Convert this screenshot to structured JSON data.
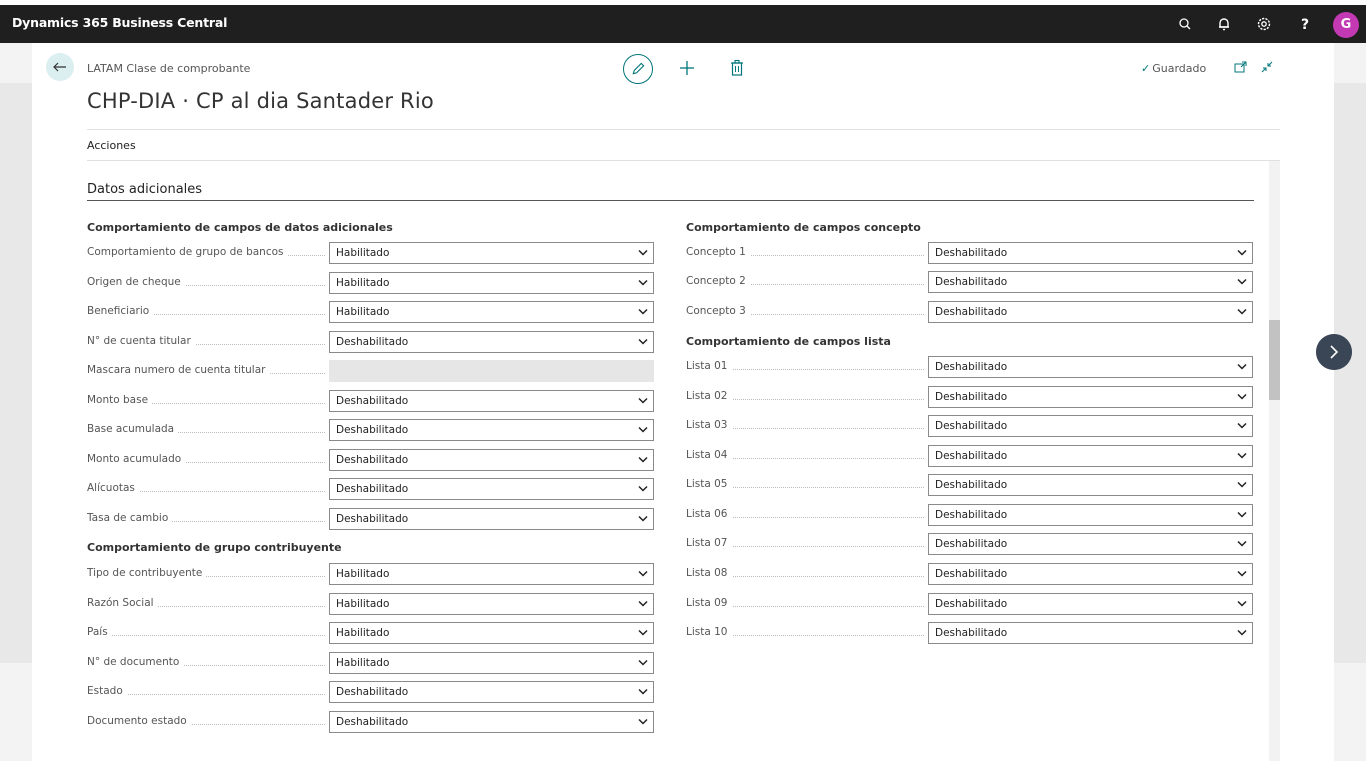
{
  "app": {
    "title": "Dynamics 365 Business Central",
    "avatar_initial": "G",
    "avatar_color": "#c239b3",
    "icons": [
      "search-icon",
      "bell-icon",
      "gear-icon",
      "help-icon"
    ]
  },
  "header": {
    "breadcrumb": "LATAM Clase de comprobante",
    "title": "CHP-DIA · CP al dia Santader Rio",
    "saved_label": "Guardado",
    "actions_label": "Acciones"
  },
  "section": {
    "title": "Datos adicionales"
  },
  "left_groups": [
    {
      "title": "Comportamiento de campos de datos adicionales",
      "fields": [
        {
          "label": "Comportamiento de grupo de bancos",
          "value": "Habilitado"
        },
        {
          "label": "Origen de cheque",
          "value": "Habilitado"
        },
        {
          "label": "Beneficiario",
          "value": "Habilitado"
        },
        {
          "label": "N° de cuenta titular",
          "value": "Deshabilitado"
        },
        {
          "label": "Mascara numero de cuenta titular",
          "value": ""
        },
        {
          "label": "Monto base",
          "value": "Deshabilitado"
        },
        {
          "label": "Base acumulada",
          "value": "Deshabilitado"
        },
        {
          "label": "Monto acumulado",
          "value": "Deshabilitado"
        },
        {
          "label": "Alícuotas",
          "value": "Deshabilitado"
        },
        {
          "label": "Tasa de cambio",
          "value": "Deshabilitado"
        }
      ]
    },
    {
      "title": "Comportamiento de grupo contribuyente",
      "fields": [
        {
          "label": "Tipo de contribuyente",
          "value": "Habilitado"
        },
        {
          "label": "Razón Social",
          "value": "Habilitado"
        },
        {
          "label": "País",
          "value": "Habilitado"
        },
        {
          "label": "N° de documento",
          "value": "Habilitado"
        },
        {
          "label": "Estado",
          "value": "Deshabilitado"
        },
        {
          "label": "Documento estado",
          "value": "Deshabilitado"
        }
      ]
    }
  ],
  "right_groups": [
    {
      "title": "Comportamiento de campos concepto",
      "fields": [
        {
          "label": "Concepto 1",
          "value": "Deshabilitado"
        },
        {
          "label": "Concepto 2",
          "value": "Deshabilitado"
        },
        {
          "label": "Concepto 3",
          "value": "Deshabilitado"
        }
      ]
    },
    {
      "title": "Comportamiento de campos lista",
      "fields": [
        {
          "label": "Lista 01",
          "value": "Deshabilitado"
        },
        {
          "label": "Lista 02",
          "value": "Deshabilitado"
        },
        {
          "label": "Lista 03",
          "value": "Deshabilitado"
        },
        {
          "label": "Lista 04",
          "value": "Deshabilitado"
        },
        {
          "label": "Lista 05",
          "value": "Deshabilitado"
        },
        {
          "label": "Lista 06",
          "value": "Deshabilitado"
        },
        {
          "label": "Lista 07",
          "value": "Deshabilitado"
        },
        {
          "label": "Lista 08",
          "value": "Deshabilitado"
        },
        {
          "label": "Lista 09",
          "value": "Deshabilitado"
        },
        {
          "label": "Lista 10",
          "value": "Deshabilitado"
        }
      ]
    }
  ],
  "colors": {
    "accent": "#00757a",
    "topbar": "#1f1f1f"
  }
}
